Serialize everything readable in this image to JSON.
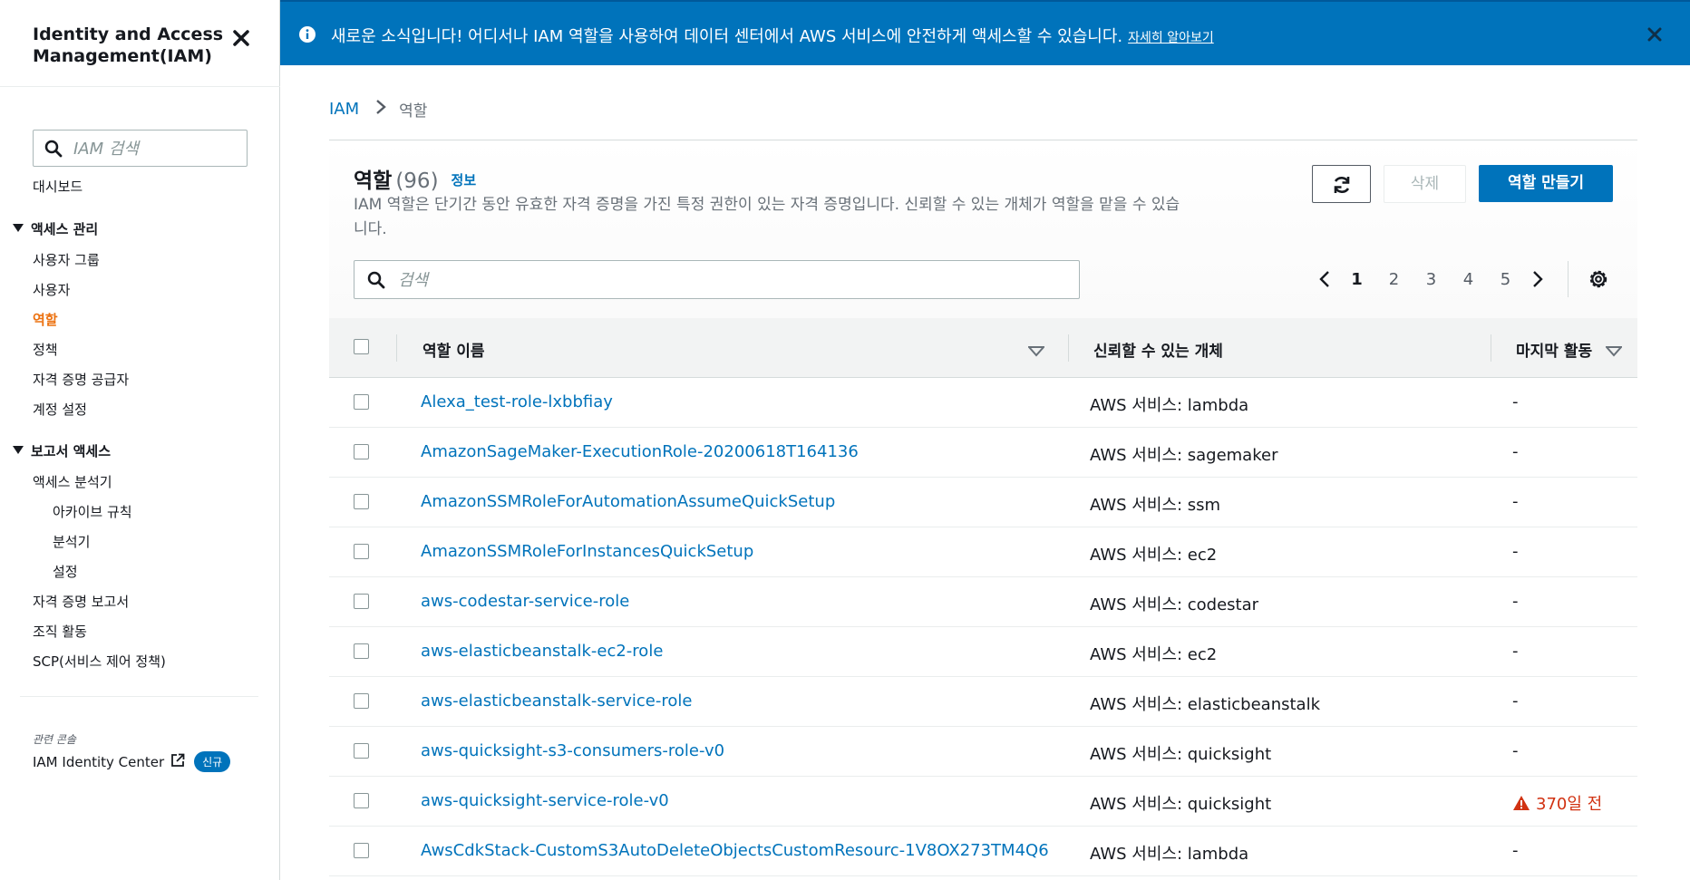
{
  "sidebar": {
    "title": "Identity and Access Management(IAM)",
    "search_placeholder": "IAM 검색",
    "dashboard": "대시보드",
    "section_access": "액세스 관리",
    "access_items": [
      "사용자 그룹",
      "사용자",
      "역할",
      "정책",
      "자격 증명 공급자",
      "계정 설정"
    ],
    "section_report": "보고서 액세스",
    "report_items": [
      "액세스 분석기",
      "아카이브 규칙",
      "분석기",
      "설정",
      "자격 증명 보고서",
      "조직 활동",
      "SCP(서비스 제어 정책)"
    ],
    "related_label": "관련 콘솔",
    "identity_center": "IAM Identity Center",
    "new_badge": "신규"
  },
  "banner": {
    "text": "새로운 소식입니다! 어디서나 IAM 역할을 사용하여 데이터 센터에서 AWS 서비스에 안전하게 액세스할 수 있습니다.",
    "link": "자세히 알아보기"
  },
  "breadcrumb": {
    "root": "IAM",
    "current": "역할"
  },
  "panel": {
    "title": "역할",
    "count": "(96)",
    "info": "정보",
    "description": "IAM 역할은 단기간 동안 유효한 자격 증명을 가진 특정 권한이 있는 자격 증명입니다. 신뢰할 수 있는 개체가 역할을 맡을 수 있습니다.",
    "delete_label": "삭제",
    "create_label": "역할 만들기",
    "search_placeholder": "검색",
    "pages": [
      "1",
      "2",
      "3",
      "4",
      "5"
    ]
  },
  "table": {
    "columns": [
      "역할 이름",
      "신뢰할 수 있는 개체",
      "마지막 활동"
    ],
    "rows": [
      {
        "name": "Alexa_test-role-lxbbfiay",
        "trust": "AWS 서비스: lambda",
        "activity": "-"
      },
      {
        "name": "AmazonSageMaker-ExecutionRole-20200618T164136",
        "trust": "AWS 서비스: sagemaker",
        "activity": "-"
      },
      {
        "name": "AmazonSSMRoleForAutomationAssumeQuickSetup",
        "trust": "AWS 서비스: ssm",
        "activity": "-"
      },
      {
        "name": "AmazonSSMRoleForInstancesQuickSetup",
        "trust": "AWS 서비스: ec2",
        "activity": "-"
      },
      {
        "name": "aws-codestar-service-role",
        "trust": "AWS 서비스: codestar",
        "activity": "-"
      },
      {
        "name": "aws-elasticbeanstalk-ec2-role",
        "trust": "AWS 서비스: ec2",
        "activity": "-"
      },
      {
        "name": "aws-elasticbeanstalk-service-role",
        "trust": "AWS 서비스: elasticbeanstalk",
        "activity": "-"
      },
      {
        "name": "aws-quicksight-s3-consumers-role-v0",
        "trust": "AWS 서비스: quicksight",
        "activity": "-"
      },
      {
        "name": "aws-quicksight-service-role-v0",
        "trust": "AWS 서비스: quicksight",
        "activity": "370일 전"
      },
      {
        "name": "AwsCdkStack-CustomS3AutoDeleteObjectsCustomResourc-1V8OX273TM4Q6",
        "trust": "AWS 서비스: lambda",
        "activity": "-"
      }
    ]
  },
  "colors": {
    "primary": "#0073bb",
    "active_nav": "#ec7211",
    "warning": "#d13212"
  }
}
